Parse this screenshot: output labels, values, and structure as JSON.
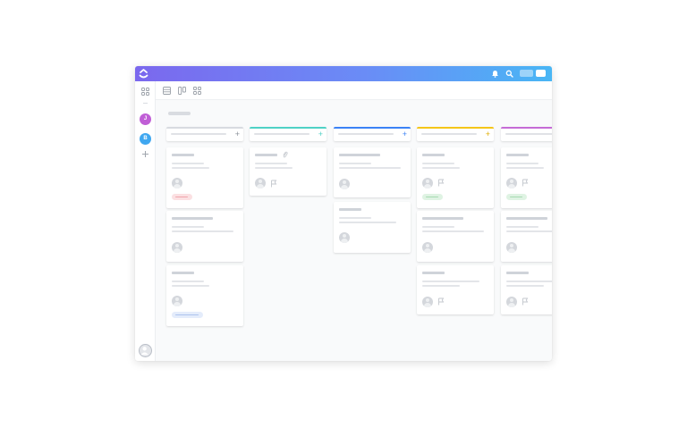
{
  "colors": {
    "topbar_gradient_start": "#7b68ee",
    "topbar_gradient_end": "#49b6f5",
    "column_1": "#d8dbe0",
    "column_2": "#4fd1c5",
    "column_3": "#3b82f6",
    "column_4": "#f5c518",
    "column_5": "#c56cd6",
    "avatar_j": "#c05ed6",
    "avatar_b": "#3fa7f0",
    "tag_red": "#fbe0e2",
    "tag_green": "#dff3e3",
    "tag_blue": "#e4ecfb"
  },
  "topbar": {
    "logo": "app-logo",
    "icons": [
      "bell-icon",
      "search-icon"
    ]
  },
  "sidebar": {
    "icons": [
      "apps-grid-icon",
      "add-space-icon"
    ],
    "avatars": [
      {
        "initial": "J",
        "color": "#c05ed6"
      },
      {
        "initial": "B",
        "color": "#3fa7f0"
      }
    ],
    "user_icon": "user-avatar-icon"
  },
  "toolbar": {
    "view_icons": [
      "list-view-icon",
      "board-view-icon",
      "box-view-icon"
    ]
  },
  "board": {
    "columns": [
      {
        "accent": "#d8dbe0",
        "cards": [
          {
            "avatar": "assignee-icon",
            "tag": "red"
          },
          {
            "avatar": "assignee-icon"
          },
          {
            "avatar": "assignee-icon",
            "tag": "blue"
          }
        ]
      },
      {
        "accent": "#4fd1c5",
        "cards": [
          {
            "avatar": "assignee-icon",
            "flag": "flag-icon",
            "attachment": "paperclip-icon"
          }
        ]
      },
      {
        "accent": "#3b82f6",
        "cards": [
          {
            "avatar": "assignee-icon"
          },
          {
            "avatar": "assignee-icon"
          }
        ]
      },
      {
        "accent": "#f5c518",
        "cards": [
          {
            "avatar": "assignee-icon",
            "flag": "flag-icon",
            "tag": "green"
          },
          {
            "avatar": "assignee-icon"
          },
          {
            "avatar": "assignee-icon",
            "flag": "flag-icon"
          }
        ]
      },
      {
        "accent": "#c56cd6",
        "cards": [
          {
            "avatar": "assignee-icon",
            "flag": "flag-icon",
            "tag": "green"
          },
          {
            "avatar": "assignee-icon"
          },
          {
            "avatar": "assignee-icon",
            "flag": "flag-icon"
          }
        ]
      }
    ]
  }
}
